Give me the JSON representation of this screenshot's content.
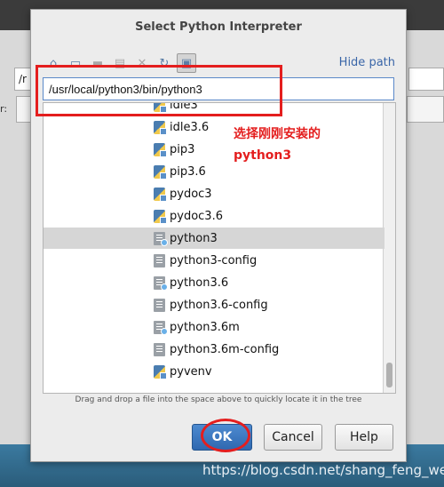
{
  "background": {
    "input_fragment": "/r",
    "label_fragment": "r:"
  },
  "dialog": {
    "title": "Select Python Interpreter",
    "toolbar": [
      {
        "name": "home-icon",
        "glyph": "⌂",
        "dim": false
      },
      {
        "name": "desktop-icon",
        "glyph": "▭",
        "dim": false
      },
      {
        "name": "folder-icon",
        "glyph": "▬",
        "dim": true
      },
      {
        "name": "new-folder-icon",
        "glyph": "▤",
        "dim": true
      },
      {
        "name": "delete-icon",
        "glyph": "✕",
        "dim": true
      },
      {
        "name": "refresh-icon",
        "glyph": "↻",
        "dim": false
      },
      {
        "name": "show-hidden-icon",
        "glyph": "▣",
        "dim": false
      }
    ],
    "hide_path_label": "Hide path",
    "path_value": "/usr/local/python3/bin/python3",
    "files": [
      {
        "label": "idle3",
        "icon": "py"
      },
      {
        "label": "idle3.6",
        "icon": "py"
      },
      {
        "label": "pip3",
        "icon": "py"
      },
      {
        "label": "pip3.6",
        "icon": "py"
      },
      {
        "label": "pydoc3",
        "icon": "py"
      },
      {
        "label": "pydoc3.6",
        "icon": "py"
      },
      {
        "label": "python3",
        "icon": "doc-link",
        "selected": true
      },
      {
        "label": "python3-config",
        "icon": "doc"
      },
      {
        "label": "python3.6",
        "icon": "doc-link"
      },
      {
        "label": "python3.6-config",
        "icon": "doc"
      },
      {
        "label": "python3.6m",
        "icon": "doc-link"
      },
      {
        "label": "python3.6m-config",
        "icon": "doc"
      },
      {
        "label": "pyvenv",
        "icon": "py"
      }
    ],
    "hint": "Drag and drop a file into the space above to quickly locate it in the tree",
    "ok_label": "OK",
    "cancel_label": "Cancel",
    "help_label": "Help"
  },
  "annotation": {
    "line1": "选择刚刚安装的",
    "line2": "python3",
    "color": "#e41e1e"
  },
  "watermark": "https://blog.csdn.net/shang_feng_wei"
}
